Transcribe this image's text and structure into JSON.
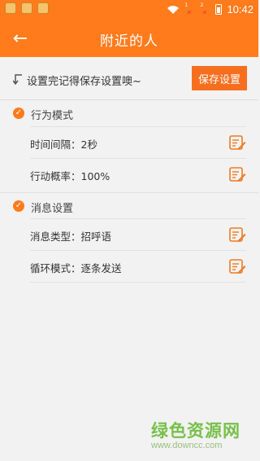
{
  "status_bar": {
    "time": "10:42",
    "sim1_label": "1",
    "sim2_label": "2",
    "no_signal_mark": "✕"
  },
  "header": {
    "back_glyph": "←",
    "title": "附近的人"
  },
  "notice": {
    "text": "设置完记得保存设置噢~",
    "save_button": "保存设置"
  },
  "sections": [
    {
      "title": "行为模式",
      "rows": [
        {
          "label": "时间间隔：2秒"
        },
        {
          "label": "行动概率：100%"
        }
      ]
    },
    {
      "title": "消息设置",
      "rows": [
        {
          "label": "消息类型：招呼语"
        },
        {
          "label": "循环模式：逐条发送"
        }
      ]
    }
  ],
  "watermark": {
    "logo": "绿色资源网",
    "url": "www.downcc.com"
  },
  "colors": {
    "accent": "#ff7b1c",
    "button": "#f66f1f",
    "background": "#f2f2f2"
  }
}
